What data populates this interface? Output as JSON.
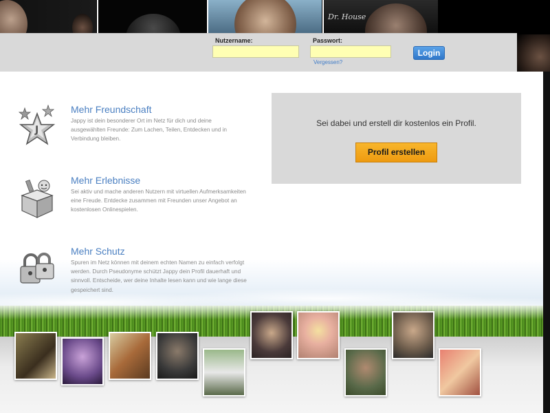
{
  "top_photos": [
    {
      "name": "photo-man-1"
    },
    {
      "name": "photo-man-2"
    },
    {
      "name": "photo-man-3"
    },
    {
      "name": "photo-dr-house",
      "caption": "Dr. House"
    }
  ],
  "login": {
    "username_label": "Nutzername:",
    "username_value": "",
    "password_label": "Passwort:",
    "password_value": "",
    "forgot_link": "Vergessen?",
    "login_button": "Login"
  },
  "features": [
    {
      "icon": "star-icon",
      "title": "Mehr Freundschaft",
      "text": "Jappy ist dein besonderer Ort im Netz für dich und deine ausgewählten Freunde: Zum Lachen, Teilen, Entdecken und in Verbindung bleiben."
    },
    {
      "icon": "gift-box-icon",
      "title": "Mehr Erlebnisse",
      "text": "Sei aktiv und mache anderen Nutzern mit virtuellen Aufmerksamkeiten eine Freude. Entdecke zusammen mit Freunden unser Angebot an kostenlosen Onlinespielen."
    },
    {
      "icon": "lock-icon",
      "title": "Mehr Schutz",
      "text": "Spuren im Netz können mit deinem echten Namen zu einfach verfolgt werden. Durch Pseudonyme schützt Jappy dein Profil dauerhaft und sinnvoll. Entscheide, wer deine Inhalte lesen kann und wie lange diese gespeichert sind."
    }
  ],
  "cta": {
    "text": "Sei dabei und erstell dir kostenlos ein Profil.",
    "button": "Profil erstellen"
  },
  "colors": {
    "accent_blue": "#4a7fc1",
    "cta_orange": "#f5a81f",
    "input_yellow": "#ffffb3"
  }
}
